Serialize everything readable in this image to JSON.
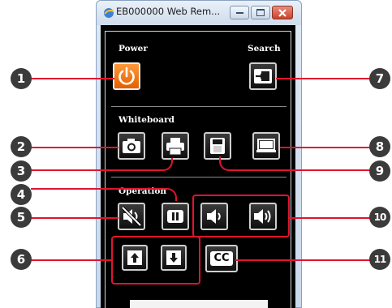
{
  "window": {
    "title": "EB000000 Web Rem..."
  },
  "sections": {
    "power_label": "Power",
    "search_label": "Search",
    "whiteboard_label": "Whiteboard",
    "operation_label": "Operation"
  },
  "buttons": {
    "cc_label": "CC"
  },
  "icons": {
    "power": "power-icon",
    "search": "source-search-icon",
    "camera": "camera-icon",
    "print": "printer-icon",
    "save": "floppy-disk-icon",
    "screen": "screen-icon",
    "mute": "av-mute-icon",
    "pause": "pause-icon",
    "volume_down": "volume-down-icon",
    "volume_up": "volume-up-icon",
    "page_up": "arrow-up-icon",
    "page_down": "arrow-down-icon"
  },
  "callouts": [
    "1",
    "2",
    "3",
    "4",
    "5",
    "6",
    "7",
    "8",
    "9",
    "10",
    "11"
  ],
  "colors": {
    "accent_orange": "#f07d1c",
    "callout_red": "#e0142e",
    "panel_black": "#000000",
    "callout_gray": "#3b3b3b"
  }
}
